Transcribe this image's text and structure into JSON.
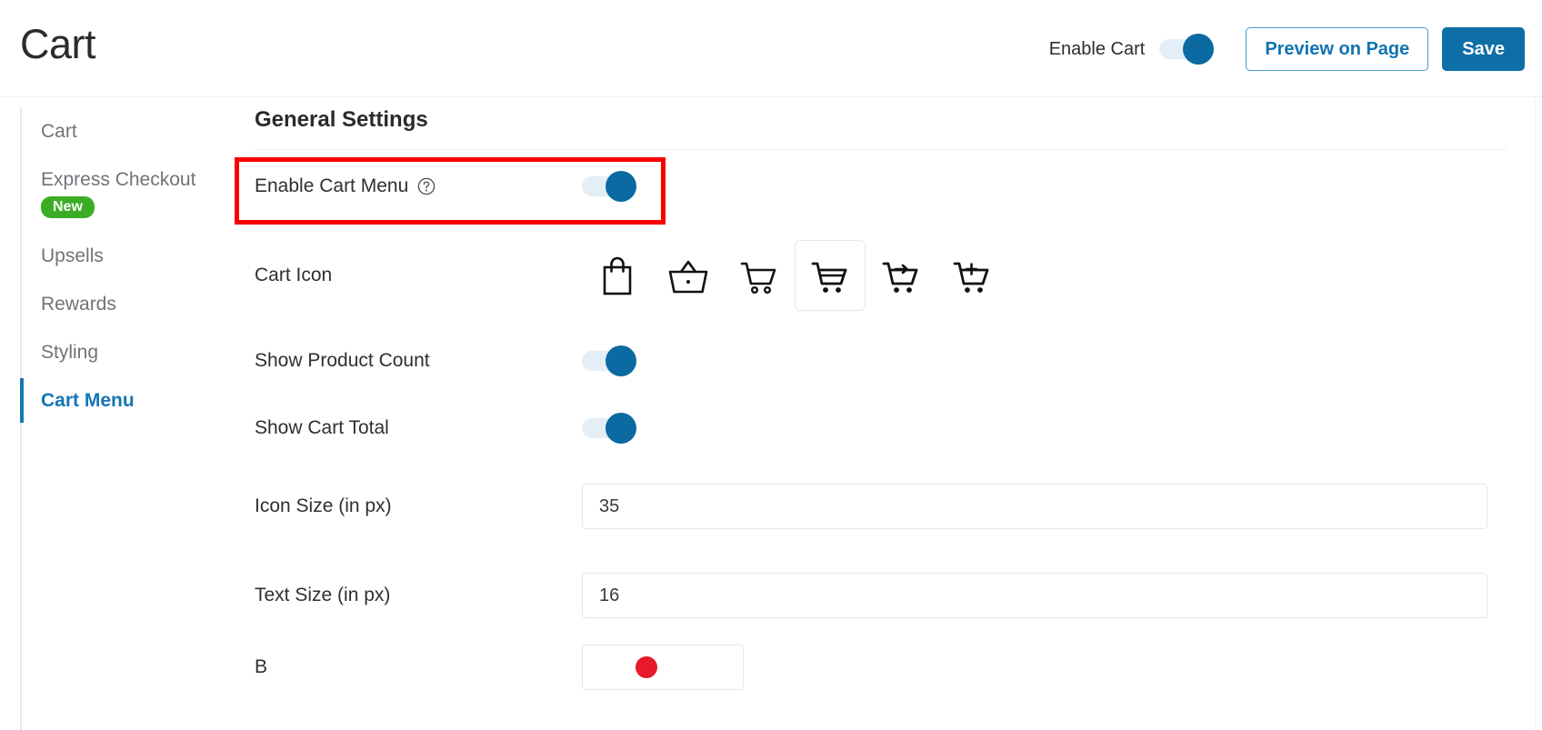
{
  "header": {
    "title": "Cart",
    "enable_cart_label": "Enable Cart",
    "enable_cart_state": "on",
    "preview_button": "Preview on Page",
    "save_button": "Save",
    "accent_blue": "#0d6fa6",
    "outline_blue": "#1273b0"
  },
  "sidebar": {
    "items": [
      {
        "label": "Cart",
        "active": false,
        "badge": null
      },
      {
        "label": "Express Checkout",
        "active": false,
        "badge": "New"
      },
      {
        "label": "Upsells",
        "active": false,
        "badge": null
      },
      {
        "label": "Rewards",
        "active": false,
        "badge": null
      },
      {
        "label": "Styling",
        "active": false,
        "badge": null
      },
      {
        "label": "Cart Menu",
        "active": true,
        "badge": null
      }
    ],
    "badge_color": "#3aad25",
    "active_color": "#1476b4"
  },
  "main": {
    "section_title": "General Settings",
    "rows": {
      "enable_cart_menu": {
        "label": "Enable Cart Menu",
        "help_icon": "question-circle-icon",
        "state": "on",
        "highlighted": true,
        "highlight_color": "#f90000"
      },
      "cart_icon": {
        "label": "Cart Icon",
        "options": [
          {
            "name": "shopping-bag-icon",
            "selected": false
          },
          {
            "name": "shopping-basket-icon",
            "selected": false
          },
          {
            "name": "shopping-cart-outline-icon",
            "selected": false
          },
          {
            "name": "shopping-cart-icon",
            "selected": true
          },
          {
            "name": "cart-arrow-icon",
            "selected": false
          },
          {
            "name": "cart-plus-icon",
            "selected": false
          }
        ]
      },
      "show_product_count": {
        "label": "Show Product Count",
        "state": "on"
      },
      "show_cart_total": {
        "label": "Show Cart Total",
        "state": "on"
      },
      "icon_size": {
        "label": "Icon Size (in px)",
        "value": "35"
      },
      "text_size": {
        "label": "Text Size (in px)",
        "value": "16"
      },
      "background": {
        "label": "B",
        "color": "#e8192c"
      }
    }
  }
}
